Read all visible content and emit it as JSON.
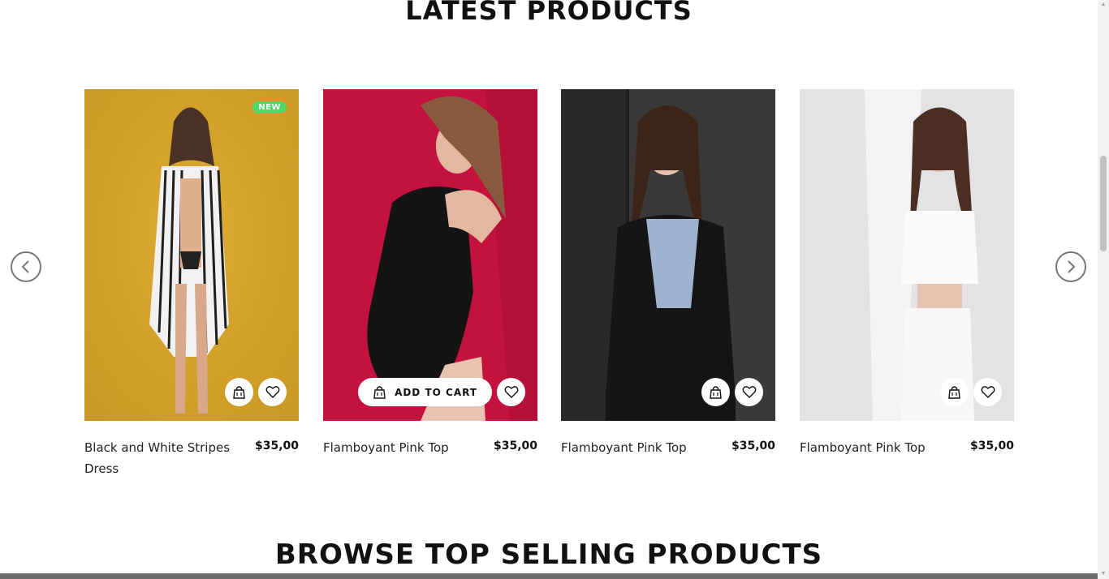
{
  "sections": {
    "latest_title": "LATEST PRODUCTS",
    "browse_title": "BROWSE TOP SELLING PRODUCTS"
  },
  "carousel": {
    "prev_icon": "chevron-left-icon",
    "next_icon": "chevron-right-icon"
  },
  "products": [
    {
      "name": "Black and White Stripes Dress",
      "price": "$35,00",
      "badge": "NEW",
      "bg_color": "#d9a62c",
      "cart_label": ""
    },
    {
      "name": "Flamboyant Pink Top",
      "price": "$35,00",
      "badge": "",
      "bg_color": "#c0123c",
      "cart_label": "ADD TO CART"
    },
    {
      "name": "Flamboyant Pink Top",
      "price": "$35,00",
      "badge": "",
      "bg_color": "#3b3a3a",
      "cart_label": ""
    },
    {
      "name": "Flamboyant Pink Top",
      "price": "$35,00",
      "badge": "",
      "bg_color": "#e4e4e6",
      "cart_label": ""
    }
  ],
  "colors": {
    "badge_green": "#4cd964",
    "text_dark": "#111111"
  }
}
